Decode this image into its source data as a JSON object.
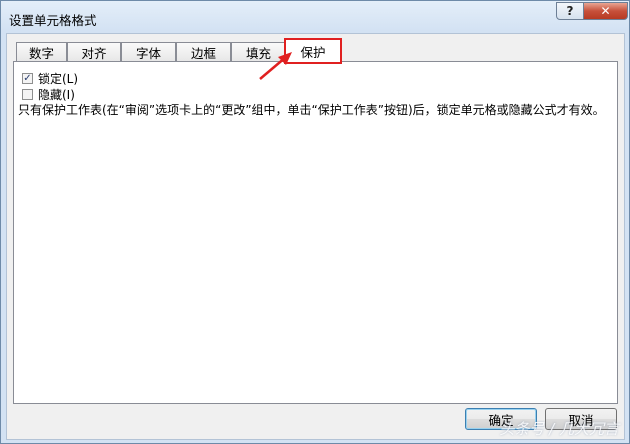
{
  "window": {
    "title": "设置单元格格式",
    "help_label": "?",
    "close_label": "✕"
  },
  "tabs": [
    {
      "label": "数字"
    },
    {
      "label": "对齐"
    },
    {
      "label": "字体"
    },
    {
      "label": "边框"
    },
    {
      "label": "填充"
    },
    {
      "label": "保护"
    }
  ],
  "active_tab": "保护",
  "protection": {
    "locked_label": "锁定(L)",
    "locked_checked": true,
    "hidden_label": "隐藏(I)",
    "hidden_checked": false,
    "description": "只有保护工作表(在“审阅”选项卡上的“更改”组中，单击“保护工作表”按钮)后，锁定单元格或隐藏公式才有效。"
  },
  "buttons": {
    "ok_label": "确定",
    "cancel_label": "取消"
  },
  "watermark": "头条号 / 几大冗言",
  "colors": {
    "highlight_border": "#e02020",
    "arrow": "#e02020"
  }
}
